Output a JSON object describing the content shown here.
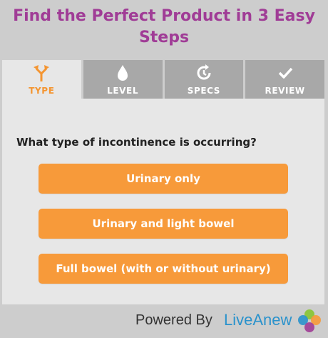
{
  "title": "Find the Perfect Product in 3 Easy Steps",
  "tabs": [
    {
      "label": "TYPE",
      "icon": "fork-arrows-icon",
      "active": true
    },
    {
      "label": "LEVEL",
      "icon": "droplet-icon",
      "active": false
    },
    {
      "label": "SPECS",
      "icon": "refresh-clock-icon",
      "active": false
    },
    {
      "label": "REVIEW",
      "icon": "check-icon",
      "active": false
    }
  ],
  "question": "What type of incontinence is occurring?",
  "answers": [
    "Urinary only",
    "Urinary and light bowel",
    "Full bowel (with or without urinary)"
  ],
  "footer": {
    "powered_by": "Powered By",
    "brand": "LiveAnew"
  },
  "colors": {
    "title": "#a03c96",
    "accent": "#f79a3a",
    "tab_inactive": "#a8a8a8",
    "panel": "#e7e7e7",
    "brand": "#2a92cc"
  }
}
